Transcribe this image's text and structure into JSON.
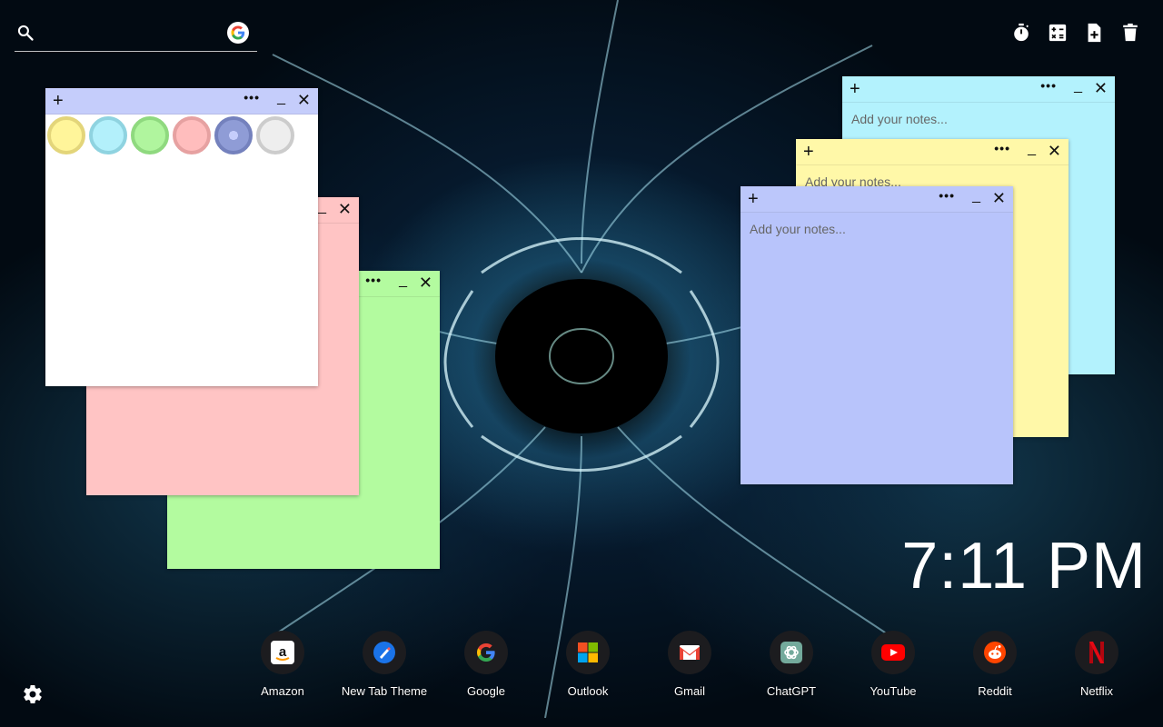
{
  "search": {
    "placeholder": "",
    "engine_icon": "google-g-icon"
  },
  "toolbar": {
    "icons": [
      "timer-icon",
      "calculator-icon",
      "add-note-icon",
      "trash-icon"
    ]
  },
  "notes": {
    "placeholder": "Add your notes...",
    "add_symbol": "+",
    "more_symbol": "•••",
    "min_symbol": "_",
    "close_symbol": "✕",
    "colors": {
      "white": "#ffffff",
      "pink": "#ffc4c4",
      "green": "#b3fb9f",
      "cyan": "#b3f2fd",
      "yellow": "#fff8a8",
      "blue": "#b8c4fb",
      "bar_blue": "#c5cdfb"
    }
  },
  "palette": {
    "swatches": [
      {
        "name": "yellow",
        "fill": "#fff59a",
        "border": "#e3d57a"
      },
      {
        "name": "cyan",
        "fill": "#b3f0fb",
        "border": "#8fd3e0"
      },
      {
        "name": "green",
        "fill": "#b0f59e",
        "border": "#8fd97f"
      },
      {
        "name": "pink",
        "fill": "#ffbdbd",
        "border": "#e6a1a1"
      },
      {
        "name": "blue",
        "fill": "#8f9cd6",
        "border": "#7481bd"
      },
      {
        "name": "gray",
        "fill": "#eeeeee",
        "border": "#cccccc"
      }
    ]
  },
  "clock": {
    "time": "7:11 PM"
  },
  "shortcuts": [
    {
      "label": "Amazon",
      "icon": "amazon-icon"
    },
    {
      "label": "New Tab Theme",
      "icon": "new-tab-theme-icon"
    },
    {
      "label": "Google",
      "icon": "google-icon"
    },
    {
      "label": "Outlook",
      "icon": "outlook-icon"
    },
    {
      "label": "Gmail",
      "icon": "gmail-icon"
    },
    {
      "label": "ChatGPT",
      "icon": "chatgpt-icon"
    },
    {
      "label": "YouTube",
      "icon": "youtube-icon"
    },
    {
      "label": "Reddit",
      "icon": "reddit-icon"
    },
    {
      "label": "Netflix",
      "icon": "netflix-icon"
    }
  ],
  "settings": {
    "icon": "gear-icon"
  }
}
